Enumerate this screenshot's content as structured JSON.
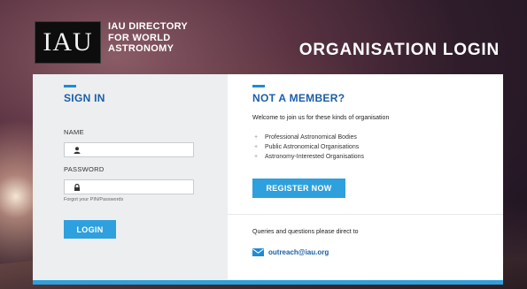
{
  "header": {
    "logo_text": "IAU",
    "directory_title": [
      "IAU DIRECTORY",
      "FOR WORLD",
      "ASTRONOMY"
    ],
    "page_title": "ORGANISATION LOGIN"
  },
  "sign_in": {
    "title": "SIGN IN",
    "name_label": "NAME",
    "name_value": "",
    "name_icon": "user-icon",
    "password_label": "PASSWORD",
    "password_value": "",
    "password_icon": "lock-icon",
    "forgot_link": "Forgot your PIN/Passwords",
    "login_button": "LOGIN"
  },
  "not_member": {
    "title": "NOT A MEMBER?",
    "welcome_text": "Welcome to join us for these kinds of organisation",
    "organisation_types": [
      "Professional Astronomical Bodies",
      "Public Astronomical Organisations",
      "Astronomy-Interested Organisations"
    ],
    "register_button": "REGISTER NOW",
    "queries_text": "Queries and questions please direct to",
    "email_icon": "envelope-icon",
    "email": "outreach@iau.org"
  },
  "colors": {
    "accent_blue": "#2ea0dd",
    "title_blue": "#1a5ea8",
    "left_panel_bg": "#eceef0"
  }
}
